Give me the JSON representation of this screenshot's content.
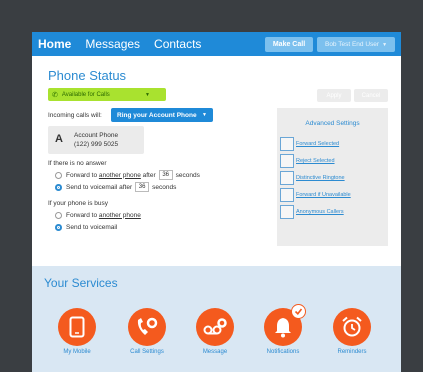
{
  "header": {
    "home": "Home",
    "tabs": [
      "Messages",
      "Contacts"
    ],
    "make_call": "Make Call",
    "user_menu": "Bob Test End User"
  },
  "phone_status": {
    "title": "Phone Status",
    "availability": "Available for Calls",
    "apply": "Apply",
    "cancel": "Cancel",
    "incoming_label": "Incoming calls will:",
    "ring_option": "Ring your Account Phone",
    "account": {
      "letter": "A",
      "name": "Account Phone",
      "number": "(122) 999 5025"
    },
    "no_answer": {
      "label": "If there is no answer",
      "forward_prefix": "Forward to",
      "forward_link": "another phone",
      "forward_after": "after",
      "forward_seconds": "36",
      "forward_suffix": "seconds",
      "voicemail_prefix": "Send to voicemail after",
      "voicemail_seconds": "36",
      "voicemail_suffix": "seconds",
      "selected": "voicemail"
    },
    "busy": {
      "label": "If your phone is busy",
      "forward_prefix": "Forward to",
      "forward_link": "another phone",
      "voicemail": "Send to voicemail",
      "selected": "voicemail"
    }
  },
  "advanced": {
    "title": "Advanced Settings",
    "items": [
      "Forward Selected",
      "Reject Selected",
      "Distinctive Ringtone",
      "Forward if Unavailable",
      "Anonymous Callers"
    ]
  },
  "services": {
    "title": "Your Services",
    "items": [
      {
        "label": "My Mobile",
        "icon": "mobile-phone-icon"
      },
      {
        "label": "Call Settings",
        "icon": "call-settings-icon"
      },
      {
        "label": "Message",
        "icon": "voicemail-settings-icon"
      },
      {
        "label": "Notifications",
        "icon": "bell-icon"
      },
      {
        "label": "Reminders",
        "icon": "alarm-clock-icon"
      }
    ]
  },
  "colors": {
    "brand_blue": "#1f8ad8",
    "available_green": "#a9e22f",
    "service_orange": "#f45a1e",
    "services_bg": "#d9e7f3"
  }
}
